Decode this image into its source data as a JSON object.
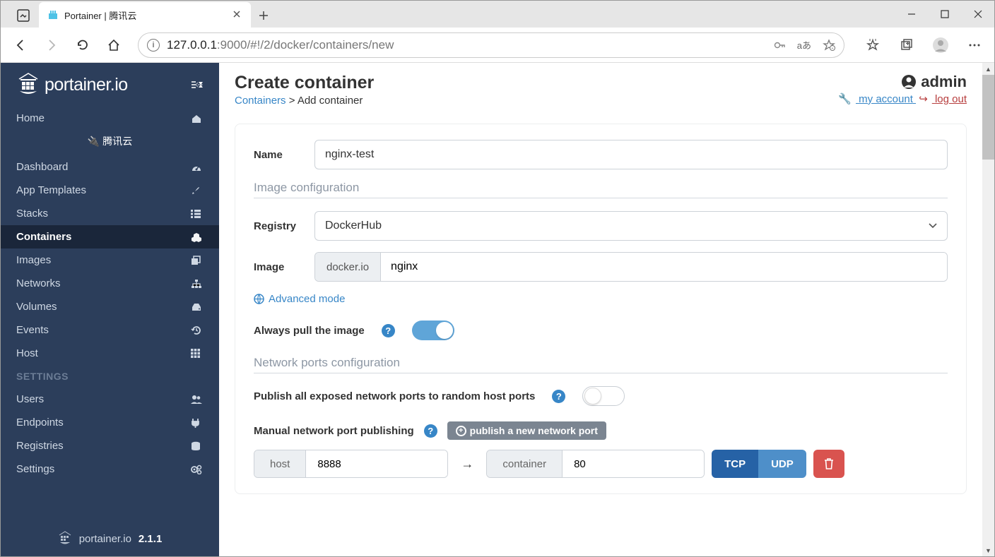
{
  "browser": {
    "tab_title": "Portainer | 腾讯云",
    "url_main": "127.0.0.1",
    "url_path": ":9000/#!/2/docker/containers/new"
  },
  "brand": "portainer.io",
  "version": "2.1.1",
  "sidebar": {
    "home": "Home",
    "env": "腾讯云",
    "items": [
      {
        "label": "Dashboard"
      },
      {
        "label": "App Templates"
      },
      {
        "label": "Stacks"
      },
      {
        "label": "Containers",
        "active": true
      },
      {
        "label": "Images"
      },
      {
        "label": "Networks"
      },
      {
        "label": "Volumes"
      },
      {
        "label": "Events"
      },
      {
        "label": "Host"
      }
    ],
    "settings_header": "SETTINGS",
    "settings": [
      {
        "label": "Users"
      },
      {
        "label": "Endpoints"
      },
      {
        "label": "Registries"
      },
      {
        "label": "Settings"
      }
    ]
  },
  "page": {
    "title": "Create container",
    "breadcrumb_link": "Containers",
    "breadcrumb_tail": "Add container",
    "username": "admin",
    "my_account": "my account",
    "logout": "log out"
  },
  "form": {
    "name_label": "Name",
    "name_value": "nginx-test",
    "image_config": "Image configuration",
    "registry_label": "Registry",
    "registry_value": "DockerHub",
    "image_label": "Image",
    "image_prefix": "docker.io",
    "image_value": "nginx",
    "advanced": "Advanced mode",
    "always_pull": "Always pull the image",
    "net_config": "Network ports configuration",
    "publish_all": "Publish all exposed network ports to random host ports",
    "manual_pub": "Manual network port publishing",
    "publish_port_btn": "publish a new network port",
    "host_lbl": "host",
    "host_val": "8888",
    "container_lbl": "container",
    "container_val": "80",
    "tcp": "TCP",
    "udp": "UDP"
  }
}
